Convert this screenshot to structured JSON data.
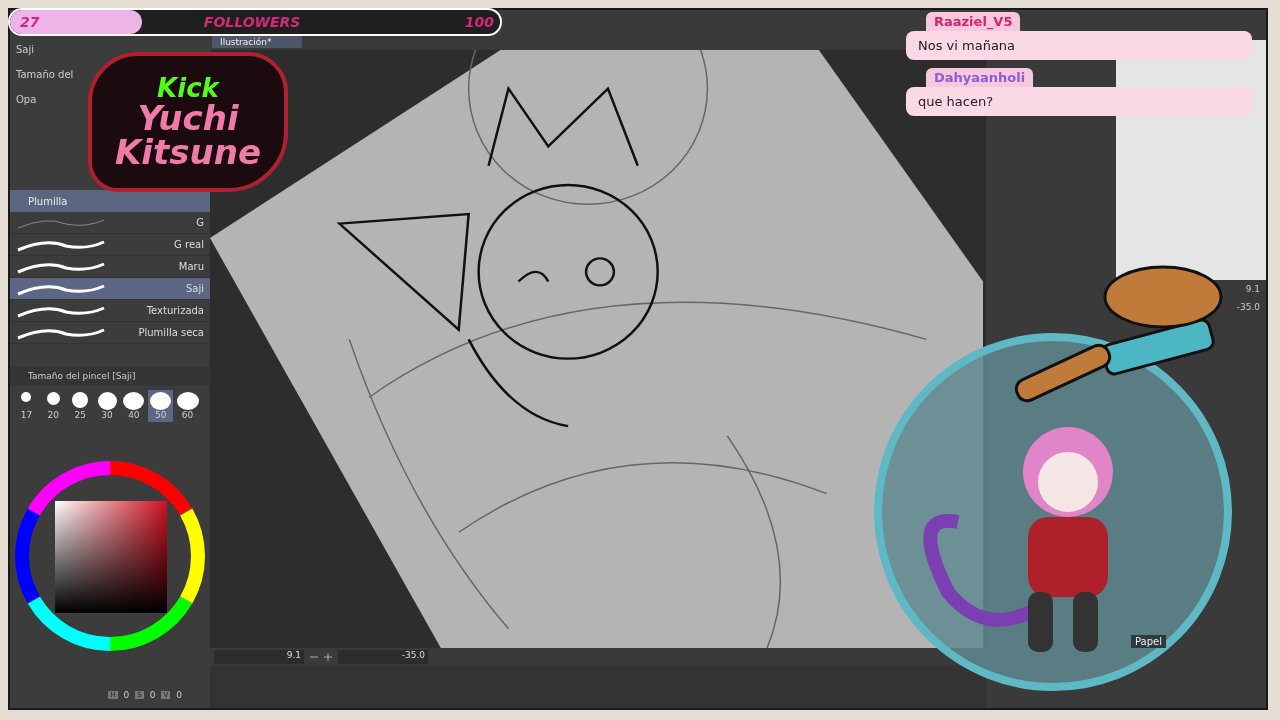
{
  "document_tab": {
    "title": "Ilustración*"
  },
  "follower_goal": {
    "current": "27",
    "label": "FOLLOWERS",
    "target": "100",
    "level": 0.27
  },
  "logo": {
    "lines": [
      "Kick",
      "Yuchi",
      "Kitsune"
    ]
  },
  "left_panel": {
    "top_labels": [
      "Saji",
      "Tamaño del",
      "Opa"
    ],
    "brush_group": "Plumilla",
    "brushes": [
      {
        "name": "G",
        "kind": "thin",
        "selected": false
      },
      {
        "name": "G real",
        "kind": "thick",
        "selected": false
      },
      {
        "name": "Maru",
        "kind": "thick",
        "selected": false
      },
      {
        "name": "Saji",
        "kind": "thick",
        "selected": true
      },
      {
        "name": "Texturizada",
        "kind": "thick",
        "selected": false
      },
      {
        "name": "Plumilla seca",
        "kind": "thick",
        "selected": false
      }
    ],
    "size_panel_title": "Tamaño del pincel [Saji]",
    "sizes": [
      {
        "value": "17",
        "selected": false
      },
      {
        "value": "20",
        "selected": false
      },
      {
        "value": "25",
        "selected": false
      },
      {
        "value": "30",
        "selected": false
      },
      {
        "value": "40",
        "selected": false
      },
      {
        "value": "50",
        "selected": true
      },
      {
        "value": "60",
        "selected": false
      }
    ],
    "color_readout": [
      {
        "key": "H",
        "value": "0"
      },
      {
        "key": "S",
        "value": "0"
      },
      {
        "key": "V",
        "value": "0"
      }
    ]
  },
  "canvas_bar": {
    "zoom": "9.1",
    "rotation": "-35.0"
  },
  "right_panel": {
    "zoom": "9.1",
    "rotation": "-35.0",
    "layer": "Papel"
  },
  "chat": [
    {
      "user": "Raaziel_V5",
      "color": "#d6246e",
      "message": "Nos vi mañana"
    },
    {
      "user": "Dahyaanholi",
      "color": "#8a5fd8",
      "message": "que hacen?"
    }
  ]
}
